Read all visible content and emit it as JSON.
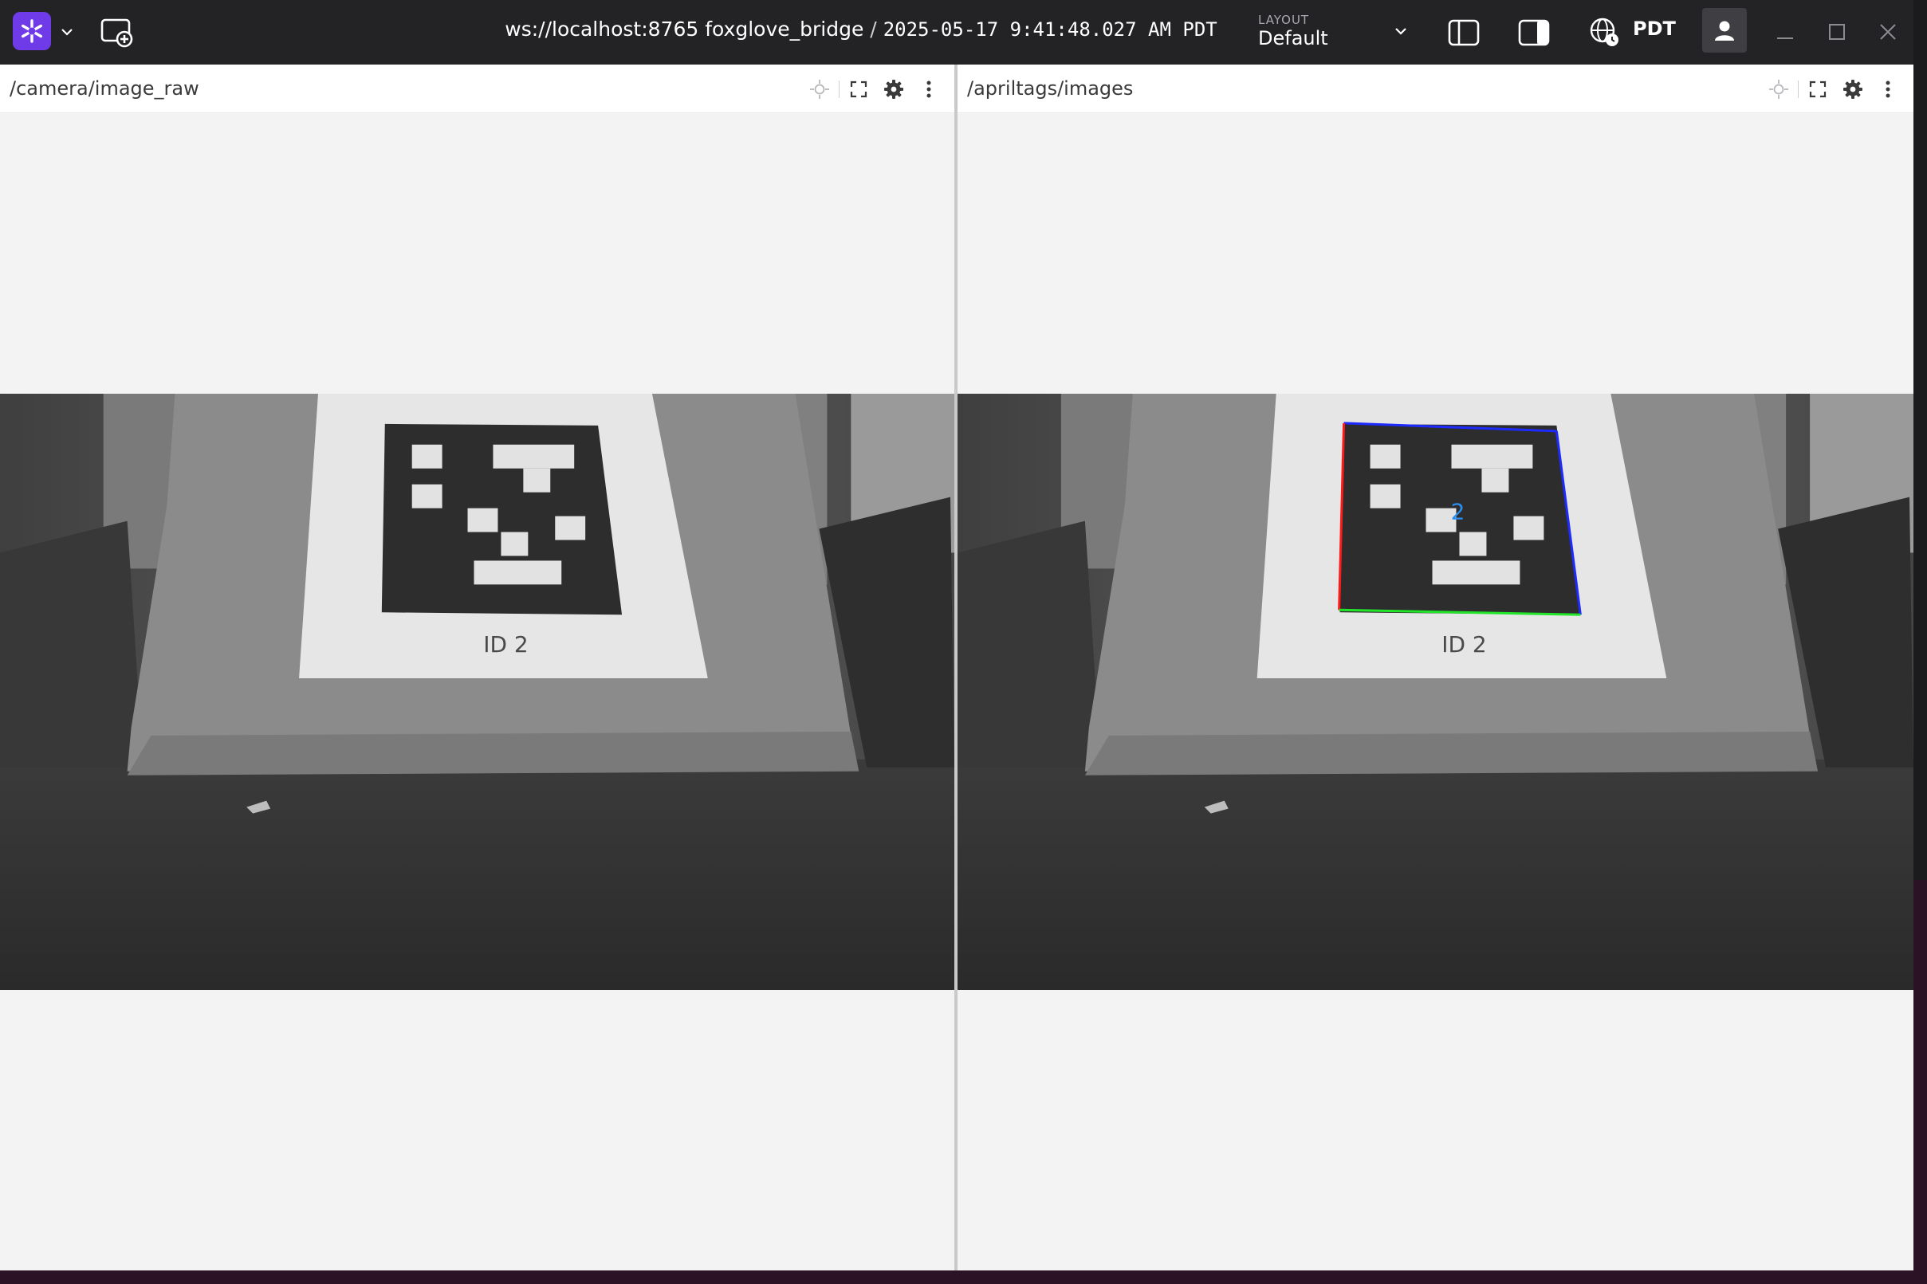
{
  "app": {
    "name": "Foxglove",
    "connection_url": "ws://localhost:8765 foxglove_bridge",
    "separator": "/",
    "timestamp": "2025-05-17 9:41:48.027 AM PDT",
    "layout_caption": "LAYOUT",
    "layout_name": "Default",
    "timezone": "PDT"
  },
  "icons": {
    "logo": "foxglove-logo-icon",
    "logo_menu": "chevron-down-icon",
    "new_window": "new-window-icon",
    "layout_menu": "chevron-down-icon",
    "left_sidebar": "left-sidebar-toggle-icon",
    "right_sidebar": "right-sidebar-toggle-icon",
    "timezone": "globe-clock-icon",
    "user": "user-icon",
    "minimize": "minimize-icon",
    "maximize": "maximize-icon",
    "close": "close-icon"
  },
  "panels": [
    {
      "topic": "/camera/image_raw",
      "image_label": "ID 2",
      "detection_overlay": false
    },
    {
      "topic": "/apriltags/images",
      "image_label": "ID 2",
      "detection_overlay": true,
      "detection_id": "2",
      "overlay_colors": {
        "top": "#1e2bff",
        "right": "#1e2bff",
        "left": "#ff1a1a",
        "bottom": "#22e52a",
        "id_text": "#2a8ef0"
      }
    }
  ],
  "colors": {
    "titlebar": "#232326",
    "accent": "#6f3be8",
    "panel_bg": "#f3f3f3"
  }
}
